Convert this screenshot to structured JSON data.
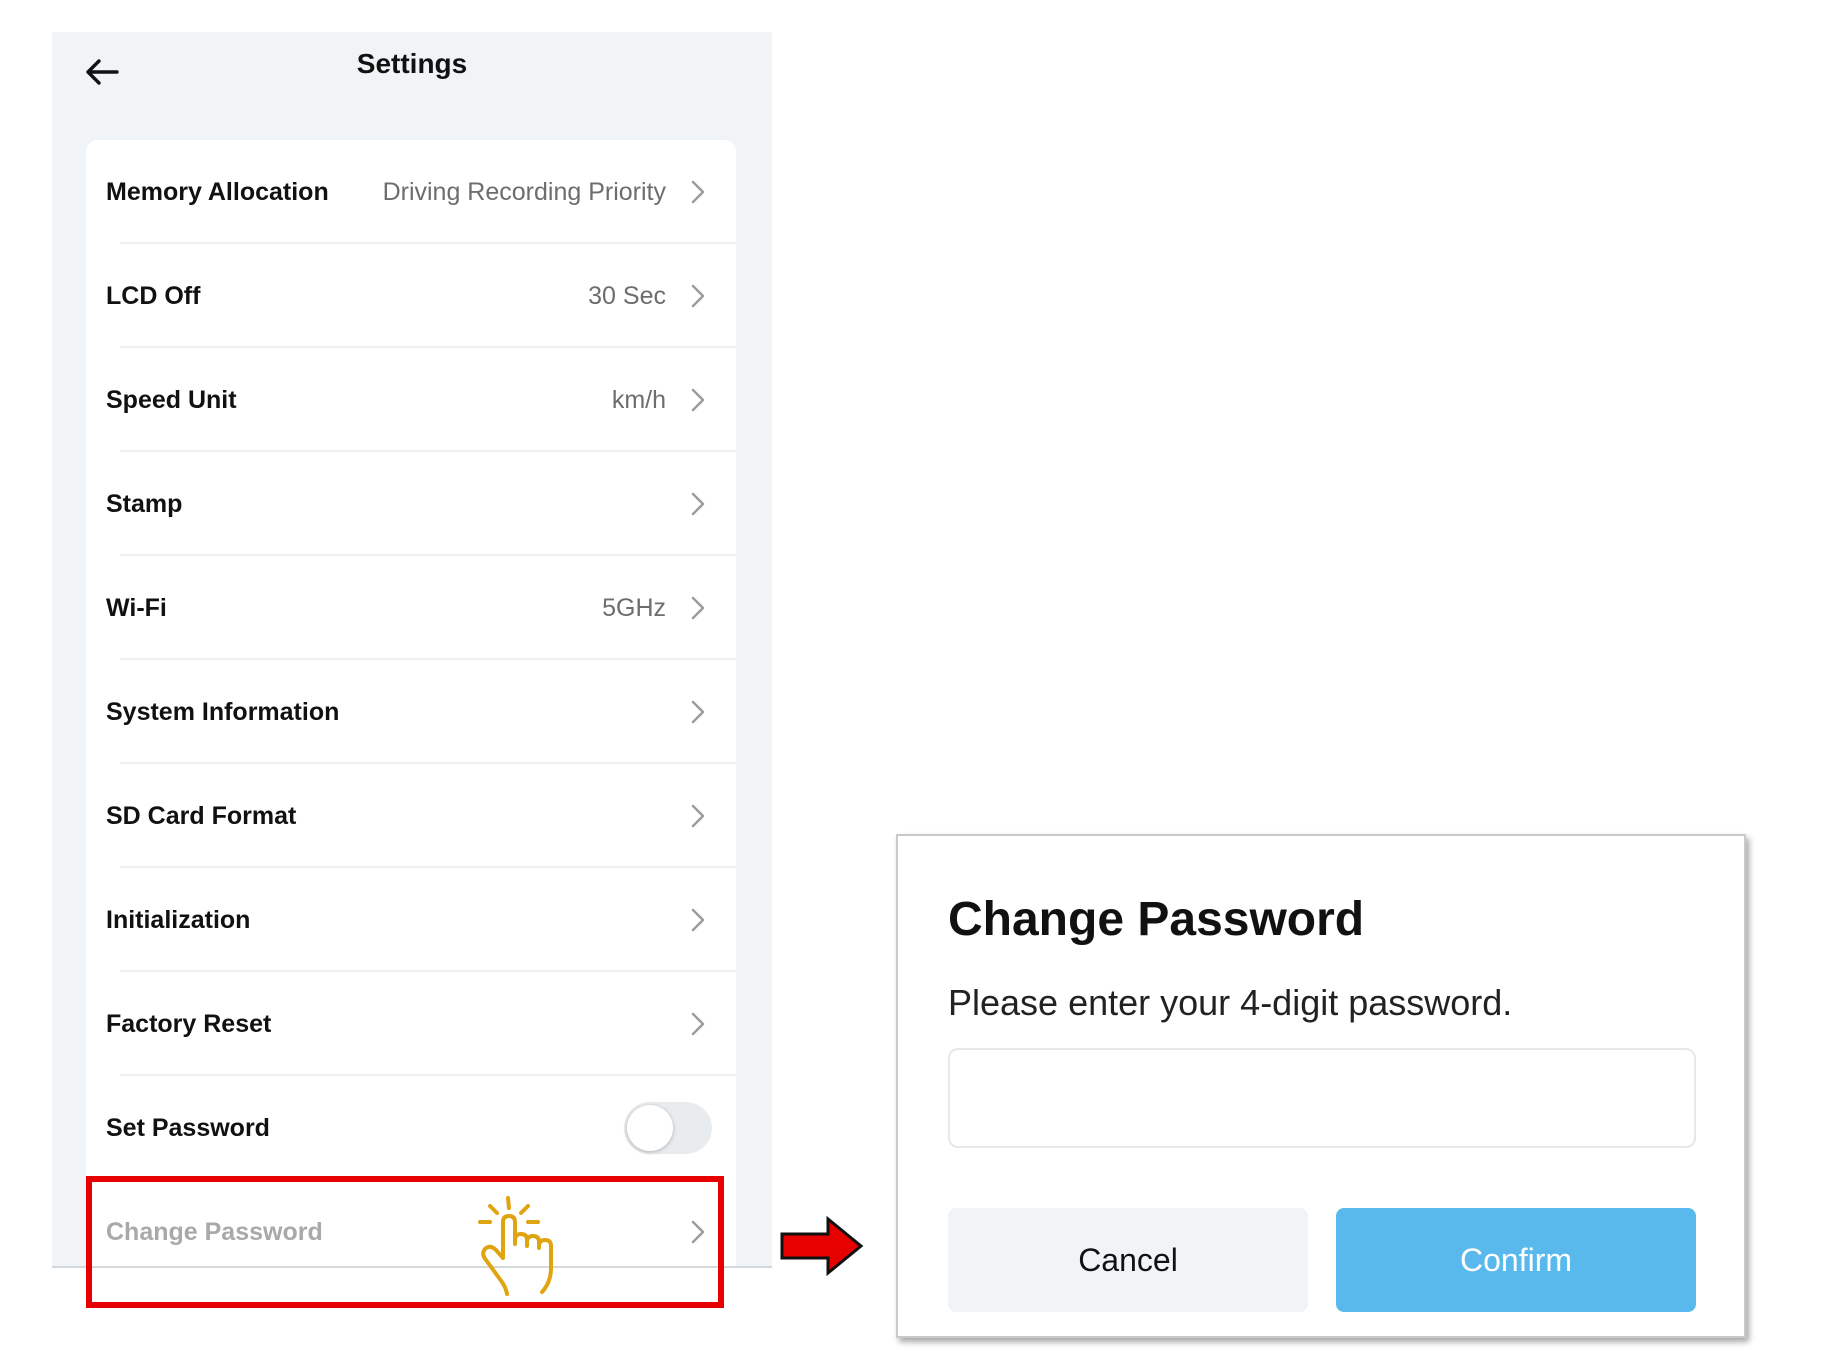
{
  "header": {
    "title": "Settings"
  },
  "settings": {
    "rows": [
      {
        "label": "Memory Allocation",
        "value": "Driving Recording Priority"
      },
      {
        "label": "LCD Off",
        "value": "30 Sec"
      },
      {
        "label": "Speed Unit",
        "value": "km/h"
      },
      {
        "label": "Stamp",
        "value": ""
      },
      {
        "label": "Wi-Fi",
        "value": "5GHz"
      },
      {
        "label": "System Information",
        "value": ""
      },
      {
        "label": "SD Card Format",
        "value": ""
      },
      {
        "label": "Initialization",
        "value": ""
      },
      {
        "label": "Factory Reset",
        "value": ""
      },
      {
        "label": "Set Password",
        "toggle": "off"
      },
      {
        "label": "Change Password",
        "value": "",
        "disabled": true
      }
    ]
  },
  "dialog": {
    "title": "Change Password",
    "message": "Please enter your 4-digit password.",
    "input_value": "",
    "cancel_label": "Cancel",
    "confirm_label": "Confirm"
  },
  "colors": {
    "highlight": "#e60000",
    "confirm": "#5ab9ec",
    "hand": "#e0a410"
  },
  "icons": [
    "back-arrow-icon",
    "chevron-right-icon",
    "pointing-hand-icon",
    "red-arrow-icon"
  ]
}
